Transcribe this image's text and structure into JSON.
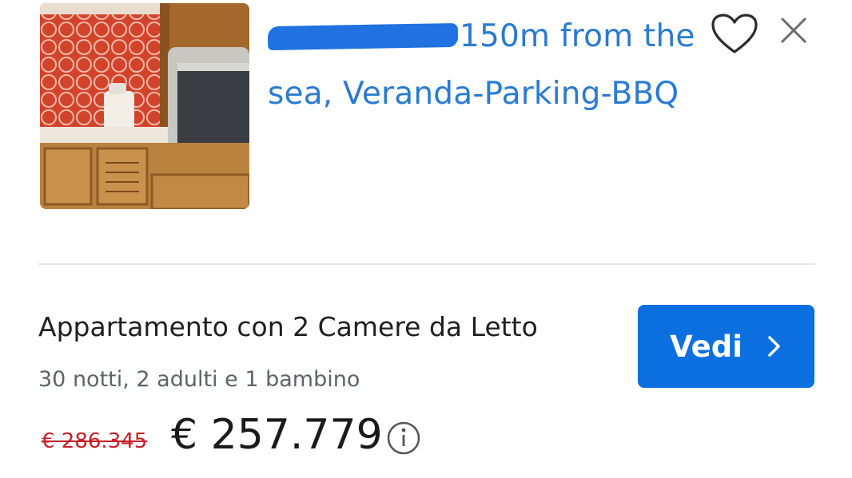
{
  "listing": {
    "title_visible": "150m from the sea, Veranda-Parking-BBQ",
    "favorite_icon": "heart-outline-icon",
    "close_icon": "close-icon",
    "room_name": "Appartamento con 2 Camere da Letto",
    "stay_info": "30 notti, 2 adulti e 1 bambino",
    "old_price": "€ 286.345",
    "price": "€ 257.779",
    "info_icon": "info-icon",
    "cta_label": "Vedi",
    "cta_icon": "chevron-right-icon"
  },
  "colors": {
    "title_link": "#2a7bd0",
    "button": "#0b6fe0",
    "old_price": "#c6202a",
    "redaction": "#1f72df"
  }
}
